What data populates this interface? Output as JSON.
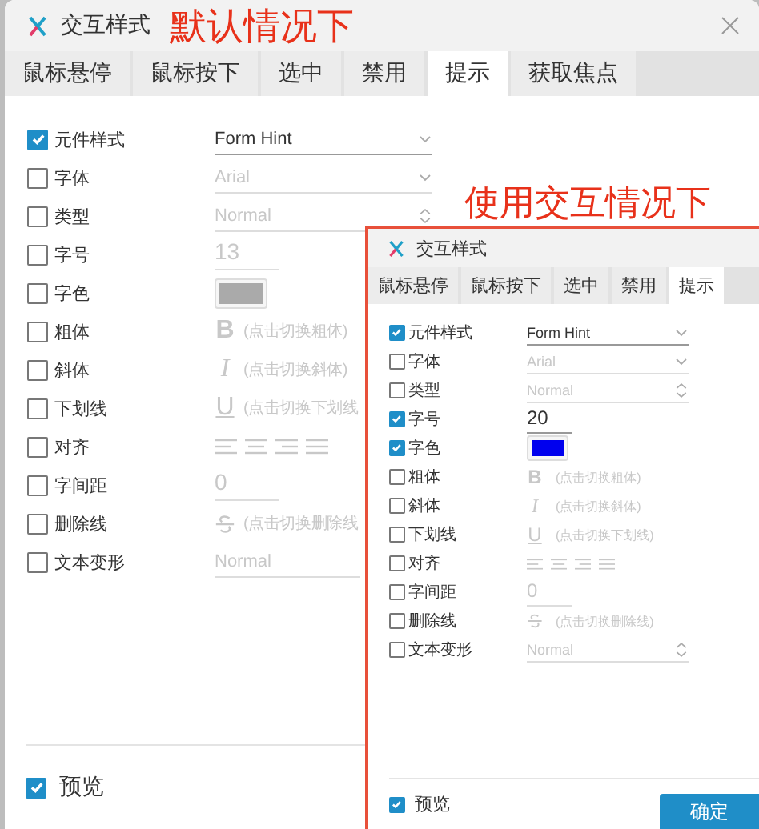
{
  "annotations": [
    {
      "text": "默认情况下"
    },
    {
      "text": "使用交互情况下"
    }
  ],
  "dialogs": [
    {
      "title": "交互样式",
      "tabs": [
        {
          "label": "鼠标悬停",
          "selected": false
        },
        {
          "label": "鼠标按下",
          "selected": false
        },
        {
          "label": "选中",
          "selected": false
        },
        {
          "label": "禁用",
          "selected": false
        },
        {
          "label": "提示",
          "selected": true
        },
        {
          "label": "获取焦点",
          "selected": false
        }
      ],
      "properties": [
        {
          "label": "元件样式",
          "checked": true,
          "kind": "select",
          "value": "Form Hint"
        },
        {
          "label": "字体",
          "checked": false,
          "kind": "select",
          "value": "Arial"
        },
        {
          "label": "类型",
          "checked": false,
          "kind": "spinner",
          "value": "Normal"
        },
        {
          "label": "字号",
          "checked": false,
          "kind": "number",
          "value": "13"
        },
        {
          "label": "字色",
          "checked": false,
          "kind": "color",
          "color": "#aaaaaa"
        },
        {
          "label": "粗体",
          "checked": false,
          "kind": "toggle",
          "glyph": "B",
          "hint": "(点击切换粗体)"
        },
        {
          "label": "斜体",
          "checked": false,
          "kind": "toggle",
          "glyph": "I",
          "hint": "(点击切换斜体)"
        },
        {
          "label": "下划线",
          "checked": false,
          "kind": "toggle",
          "glyph": "U",
          "hint": "(点击切换下划线"
        },
        {
          "label": "对齐",
          "checked": false,
          "kind": "align"
        },
        {
          "label": "字间距",
          "checked": false,
          "kind": "number",
          "value": "0"
        },
        {
          "label": "删除线",
          "checked": false,
          "kind": "strike",
          "hint": "(点击切换删除线"
        },
        {
          "label": "文本变形",
          "checked": false,
          "kind": "spinner",
          "value": "Normal"
        }
      ],
      "preview": {
        "label": "预览",
        "checked": true
      }
    },
    {
      "title": "交互样式",
      "tabs": [
        {
          "label": "鼠标悬停",
          "selected": false
        },
        {
          "label": "鼠标按下",
          "selected": false
        },
        {
          "label": "选中",
          "selected": false
        },
        {
          "label": "禁用",
          "selected": false
        },
        {
          "label": "提示",
          "selected": true
        }
      ],
      "properties": [
        {
          "label": "元件样式",
          "checked": true,
          "kind": "select",
          "value": "Form Hint"
        },
        {
          "label": "字体",
          "checked": false,
          "kind": "select",
          "value": "Arial"
        },
        {
          "label": "类型",
          "checked": false,
          "kind": "spinner",
          "value": "Normal"
        },
        {
          "label": "字号",
          "checked": true,
          "kind": "number",
          "value": "20"
        },
        {
          "label": "字色",
          "checked": true,
          "kind": "color",
          "color": "#0000ee"
        },
        {
          "label": "粗体",
          "checked": false,
          "kind": "toggle",
          "glyph": "B",
          "hint": "(点击切换粗体)"
        },
        {
          "label": "斜体",
          "checked": false,
          "kind": "toggle",
          "glyph": "I",
          "hint": "(点击切换斜体)"
        },
        {
          "label": "下划线",
          "checked": false,
          "kind": "toggle",
          "glyph": "U",
          "hint": "(点击切换下划线)"
        },
        {
          "label": "对齐",
          "checked": false,
          "kind": "align"
        },
        {
          "label": "字间距",
          "checked": false,
          "kind": "number",
          "value": "0"
        },
        {
          "label": "删除线",
          "checked": false,
          "kind": "strike",
          "hint": "(点击切换删除线)"
        },
        {
          "label": "文本变形",
          "checked": false,
          "kind": "spinner",
          "value": "Normal"
        }
      ],
      "preview": {
        "label": "预览",
        "checked": true
      },
      "confirm_button": "确定"
    }
  ]
}
